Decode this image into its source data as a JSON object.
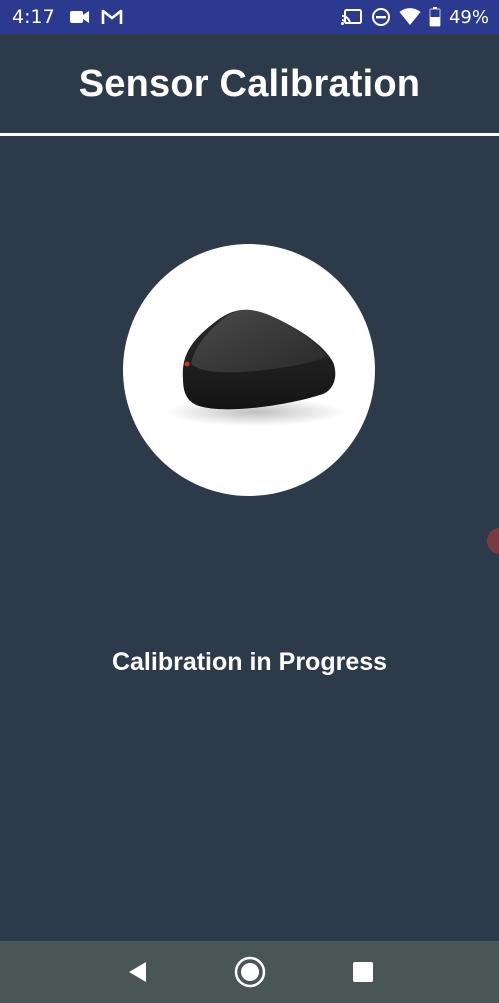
{
  "status_bar": {
    "time": "4:17",
    "battery_percent": "49%",
    "left_icons": [
      "video-camera-icon",
      "gmail-icon"
    ],
    "right_icons": [
      "cast-icon",
      "do-not-disturb-icon",
      "wifi-icon",
      "battery-icon"
    ]
  },
  "header": {
    "title": "Sensor Calibration"
  },
  "main": {
    "device_image": "sensor-device-image",
    "status_text": "Calibration in Progress"
  },
  "nav_bar": {
    "buttons": [
      "back-icon",
      "home-icon",
      "recents-icon"
    ]
  },
  "colors": {
    "background": "#2c3a49",
    "status_bar": "#2b3a8f",
    "nav_bar": "#4a5556",
    "text": "#ffffff"
  }
}
